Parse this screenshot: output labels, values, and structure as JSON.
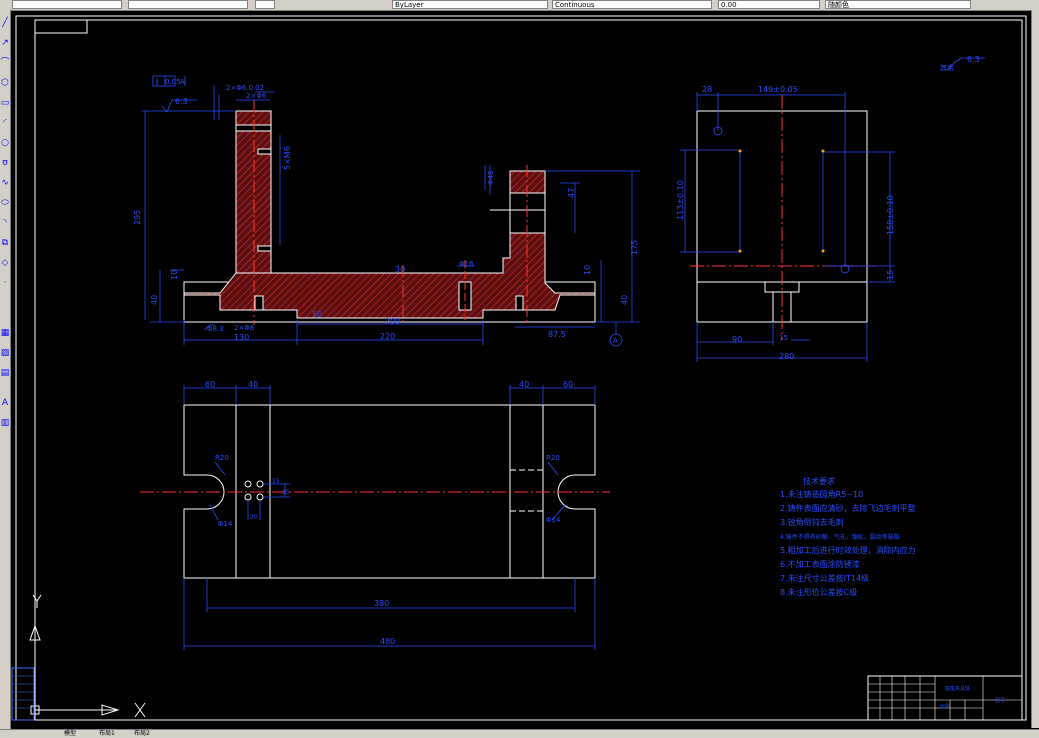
{
  "toolbar": {
    "layer": "ByLayer",
    "field2": "ByLayer",
    "field3": "Continuous",
    "field4": "0.00",
    "field5": "随颜色"
  },
  "left_toolbar": {
    "tools": [
      "line-icon",
      "polyline-icon",
      "arc-icon",
      "polygon-icon",
      "rectangle-icon",
      "arc2-icon",
      "circle-icon",
      "revcloud-icon",
      "spline-icon",
      "ellipse-icon",
      "ellipse-arc-icon",
      "insert-block-icon",
      "make-block-icon",
      "point-icon",
      "hatch-icon",
      "region-icon",
      "table-icon",
      "mtext-icon"
    ]
  },
  "layout_tabs": [
    "模型",
    "布局1",
    "布局2"
  ],
  "drawing": {
    "tech_req_title": "技术要求",
    "tech_req": [
      "1.未注铸造圆角R5~10",
      "2.铸件表面应清砂，去除飞边毛刺平整",
      "3.锐角倒钝去毛刺",
      "4.铸件不得有砂眼、气孔、缩松、裂纹等缺陷",
      "5.粗加工后进行时效处理，消除内应力",
      "6.不加工表面涂防锈漆",
      "7.未注尺寸公差按IT14级",
      "8.未注形位公差按C级"
    ],
    "front_view": {
      "flatness": "0.05",
      "flat_ref": "A",
      "rough_left": "6.3",
      "dims": [
        "2×Φ6.0.02",
        "2×Φ6",
        "10",
        "Φ16",
        "295",
        "10",
        "Φ48",
        "5×M6",
        "Φ48",
        "30",
        "Φ40",
        "195",
        "10",
        "47",
        "175",
        "10",
        "40",
        "Φ8.3",
        "2×Φ8",
        "130",
        "220",
        "50",
        "Φ20",
        "87.5",
        "A"
      ]
    },
    "side_view": {
      "rough": "6.3",
      "dims": [
        "28",
        "149±0.05",
        "113±0.10",
        "158±0.10",
        "15",
        "90",
        "15",
        "280"
      ]
    },
    "top_view": {
      "dims": [
        "60",
        "40",
        "40",
        "60",
        "R20",
        "R20",
        "Φ14",
        "Φ14",
        "15",
        "15",
        "20",
        "380",
        "480"
      ]
    },
    "ucs": {
      "x": "X",
      "y": "Y"
    },
    "title_block": {
      "drawing_name": "底座夹具体",
      "scale": "比例"
    }
  }
}
